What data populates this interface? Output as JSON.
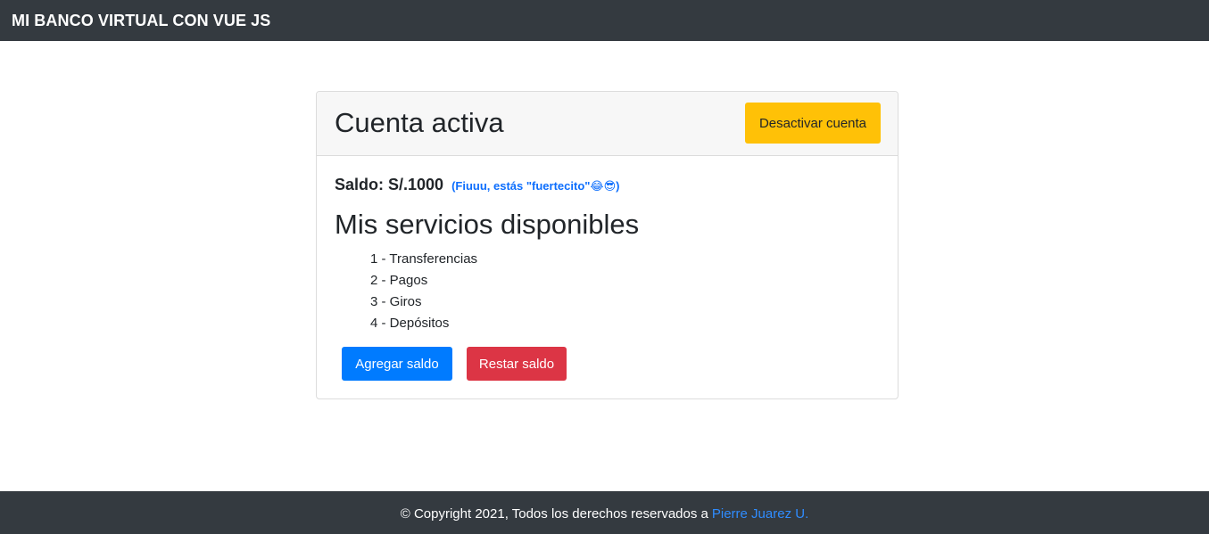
{
  "navbar": {
    "brand": "MI BANCO VIRTUAL CON VUE JS"
  },
  "account": {
    "title": "Cuenta activa",
    "deactivate_label": "Desactivar cuenta",
    "balance_label": "Saldo: S/.1000",
    "balance_note": "(Fiuuu, estás \"fuertecito\"😂😎)",
    "services_title": "Mis servicios disponibles",
    "services": [
      "1 - Transferencias",
      "2 - Pagos",
      "3 - Giros",
      "4 - Depósitos"
    ],
    "add_label": "Agregar saldo",
    "subtract_label": "Restar saldo"
  },
  "footer": {
    "text": "© Copyright 2021, Todos los derechos reservados a",
    "author_link": "Pierre Juarez U."
  },
  "colors": {
    "navbar_bg": "#343a40",
    "warning": "#ffc107",
    "primary": "#007bff",
    "danger": "#dc3545",
    "link": "#2f8cff"
  }
}
